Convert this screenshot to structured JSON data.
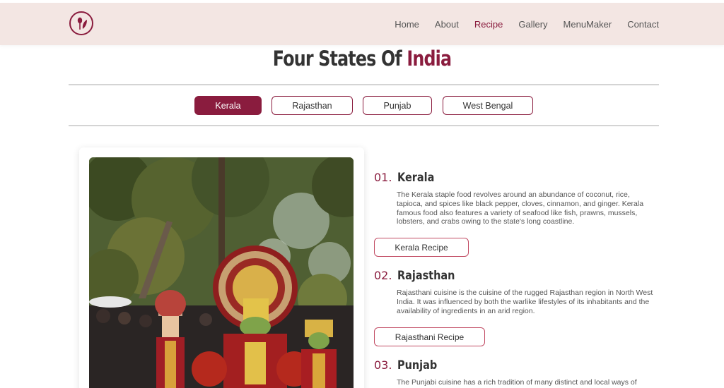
{
  "header": {
    "logo_icon": "spoon-leaf-icon",
    "nav": [
      {
        "label": "Home"
      },
      {
        "label": "About"
      },
      {
        "label": "Recipe",
        "active": true
      },
      {
        "label": "Gallery"
      },
      {
        "label": "MenuMaker"
      },
      {
        "label": "Contact"
      }
    ]
  },
  "page": {
    "title_main": "Four States Of",
    "title_accent": "India"
  },
  "tabs": [
    {
      "label": "Kerala",
      "active": true
    },
    {
      "label": "Rajasthan"
    },
    {
      "label": "Punjab"
    },
    {
      "label": "West Bengal"
    }
  ],
  "states": [
    {
      "number": "01.",
      "name": "Kerala",
      "description": "The Kerala staple food revolves around an abundance of coconut, rice, tapioca, and spices like black pepper, cloves, cinnamon, and ginger. Kerala famous food also features a variety of seafood like fish, prawns, mussels, lobsters, and crabs owing to the state's long coastline.",
      "button": "Kerala Recipe"
    },
    {
      "number": "02.",
      "name": "Rajasthan",
      "description": "Rajasthani cuisine is the cuisine of the rugged Rajasthan region in North West India. It was influenced by both the warlike lifestyles of its inhabitants and the availability of ingredients in an arid region.",
      "button": "Rajasthani Recipe"
    },
    {
      "number": "03.",
      "name": "Punjab",
      "description": "The Punjabi cuisine has a rich tradition of many distinct and local ways of"
    }
  ],
  "colors": {
    "accent": "#8a1c3e",
    "header_bg": "#f3e6e3"
  }
}
